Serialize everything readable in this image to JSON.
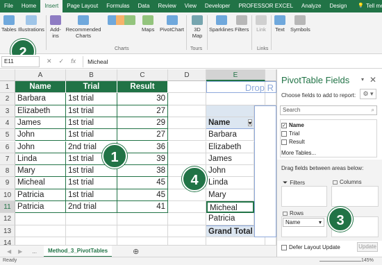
{
  "ribbon_tabs": [
    "File",
    "Home",
    "Insert",
    "Page Layout",
    "Formulas",
    "Data",
    "Review",
    "View",
    "Developer",
    "PROFESSOR EXCEL",
    "Analyze",
    "Design"
  ],
  "active_tab": "Insert",
  "tell_me": "Tell me",
  "ribbon_buttons": {
    "tables": "Tables",
    "illustrations": "Illustrations",
    "addins": "Add-ins",
    "recommended_charts": "Recommended Charts",
    "maps": "Maps",
    "pivotchart": "PivotChart",
    "map3d": "3D Map",
    "sparklines": "Sparklines",
    "filters": "Filters",
    "link": "Link",
    "text": "Text",
    "symbols": "Symbols"
  },
  "group_labels": {
    "charts": "Charts",
    "tours": "Tours",
    "links": "Links"
  },
  "formula_bar": {
    "name_box": "E11",
    "value": "Micheal"
  },
  "columns": [
    "A",
    "B",
    "C",
    "D",
    "E"
  ],
  "rows": [
    "1",
    "2",
    "3",
    "4",
    "5",
    "6",
    "7",
    "8",
    "9",
    "10",
    "11",
    "12",
    "13",
    "14"
  ],
  "table": {
    "headers": [
      "Name",
      "Trial",
      "Result"
    ],
    "rows": [
      [
        "Barbara",
        "1st trial",
        "30"
      ],
      [
        "Elizabeth",
        "1st trial",
        "27"
      ],
      [
        "James",
        "1st trial",
        "29"
      ],
      [
        "John",
        "1st trial",
        "27"
      ],
      [
        "John",
        "2nd trial",
        "36"
      ],
      [
        "Linda",
        "1st trial",
        "39"
      ],
      [
        "Mary",
        "1st trial",
        "38"
      ],
      [
        "Micheal",
        "1st trial",
        "45"
      ],
      [
        "Patricia",
        "1st trial",
        "45"
      ],
      [
        "Patricia",
        "2nd trial",
        "41"
      ]
    ]
  },
  "pivot": {
    "drop_hint": "Drop R",
    "header": "Name",
    "items": [
      "Barbara",
      "Elizabeth",
      "James",
      "John",
      "Linda",
      "Mary",
      "Micheal",
      "Patricia"
    ],
    "total": "Grand Total"
  },
  "badges": [
    "1",
    "2",
    "3",
    "4"
  ],
  "sheet_tab": "Method_3_PivotTables",
  "sheet_nav": "...",
  "zoom": "145%",
  "status_left": "Ready",
  "panel": {
    "title": "PivotTable Fields",
    "subtitle": "Choose fields to add to report:",
    "search_placeholder": "Search",
    "fields": [
      {
        "label": "Name",
        "checked": true
      },
      {
        "label": "Trial",
        "checked": false
      },
      {
        "label": "Result",
        "checked": false
      }
    ],
    "more_tables": "More Tables...",
    "drag_label": "Drag fields between areas below:",
    "filters_label": "Filters",
    "columns_label": "Columns",
    "rows_label": "Rows",
    "rows_field": "Name",
    "defer_label": "Defer Layout Update",
    "update_label": "Update"
  }
}
